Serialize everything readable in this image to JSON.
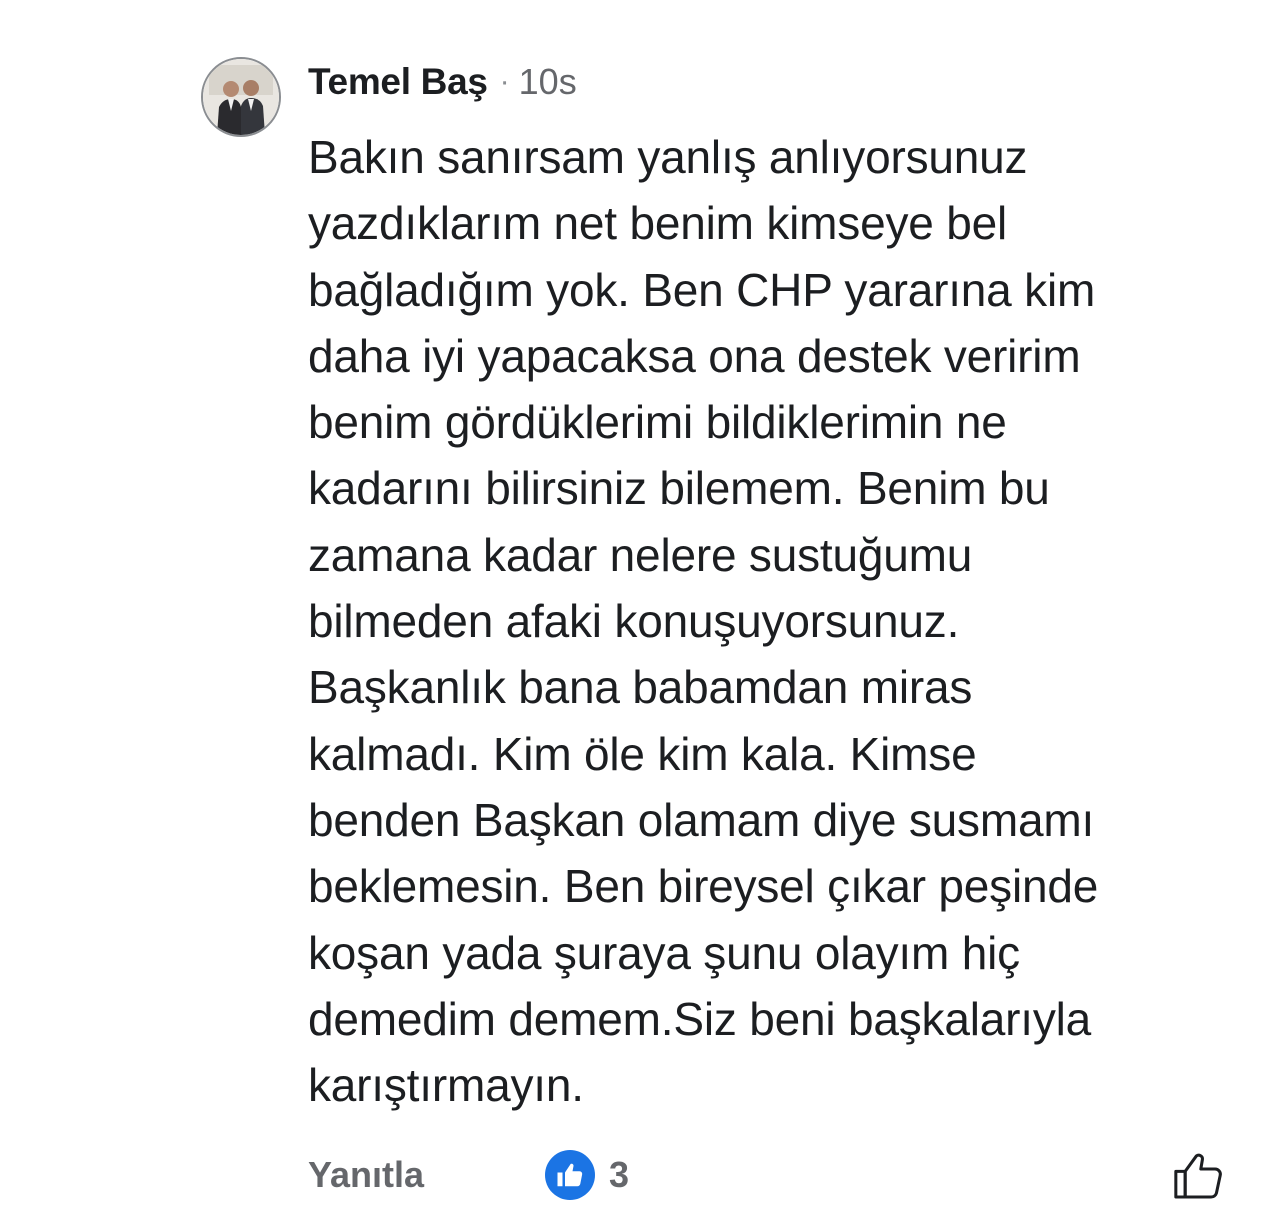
{
  "comment": {
    "author": "Temel Baş",
    "separator": "·",
    "time": "10s",
    "avatar_icon": "profile-photo-avatar",
    "body_lines": [
      "Bakın sanırsam yanlış anlıyorsunuz",
      "yazdıklarım net benim kimseye bel",
      "bağladığım yok. Ben CHP yararına kim",
      "daha iyi yapacaksa ona destek veririm",
      "benim gördüklerimi bildiklerimin ne",
      "kadarını bilirsiniz bilemem. Benim bu",
      "zamana kadar nelere sustuğumu",
      "bilmeden afaki konuşuyorsunuz.",
      "Başkanlık bana babamdan miras",
      "kalmadı. Kim öle kim kala. Kimse",
      "benden Başkan olamam diye susmamı",
      "beklemesin. Ben bireysel çıkar peşinde",
      "koşan yada şuraya şunu olayım hiç",
      "demedim demem.Siz beni başkalarıyla",
      "karıştırmayın."
    ]
  },
  "actions": {
    "reply_label": "Yanıtla",
    "reaction_icon": "like-reaction-icon",
    "reaction_count": "3",
    "like_icon": "thumbs-up-outline-icon"
  },
  "colors": {
    "text": "#1c1e21",
    "secondary": "#65676b",
    "like_blue": "#1b74e4",
    "background": "#ffffff"
  }
}
